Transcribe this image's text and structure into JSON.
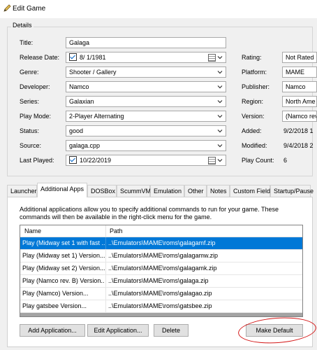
{
  "window": {
    "title": "Edit Game",
    "icon": "pencil-icon"
  },
  "details": {
    "group_label": "Details",
    "title": {
      "label": "Title:",
      "value": "Galaga"
    },
    "release_date": {
      "label": "Release Date:",
      "value": "8/  1/1981",
      "checked": true
    },
    "genre": {
      "label": "Genre:",
      "value": "Shooter / Gallery"
    },
    "developer": {
      "label": "Developer:",
      "value": "Namco"
    },
    "series": {
      "label": "Series:",
      "value": "Galaxian"
    },
    "play_mode": {
      "label": "Play Mode:",
      "value": "2-Player Alternating"
    },
    "status": {
      "label": "Status:",
      "value": "good"
    },
    "source": {
      "label": "Source:",
      "value": "galaga.cpp"
    },
    "last_played": {
      "label": "Last Played:",
      "value": "10/22/2019",
      "checked": true
    },
    "rating": {
      "label": "Rating:",
      "value": "Not Rated"
    },
    "platform": {
      "label": "Platform:",
      "value": "MAME"
    },
    "publisher": {
      "label": "Publisher:",
      "value": "Namco"
    },
    "region": {
      "label": "Region:",
      "value": "North Ame"
    },
    "version": {
      "label": "Version:",
      "value": "(Namco rev"
    },
    "added": {
      "label": "Added:",
      "value": "9/2/2018 1"
    },
    "modified": {
      "label": "Modified:",
      "value": "9/4/2018 2"
    },
    "play_count": {
      "label": "Play Count:",
      "value": "6"
    }
  },
  "tabs": [
    "Launcher",
    "Additional Apps",
    "DOSBox",
    "ScummVM",
    "Emulation",
    "Other",
    "Notes",
    "Custom Fields",
    "Startup/Pause"
  ],
  "active_tab": "Additional Apps",
  "additional_apps": {
    "description": "Additional applications allow you to specify additional commands to run for your game.  These commands will then be available in the right-click menu for the game.",
    "columns": [
      "Name",
      "Path"
    ],
    "rows": [
      {
        "name": "Play (Midway set 1 with fast ...",
        "path": "..\\Emulators\\MAME\\roms\\galagamf.zip",
        "selected": true
      },
      {
        "name": "Play (Midway set 1) Version...",
        "path": "..\\Emulators\\MAME\\roms\\galagamw.zip",
        "selected": false
      },
      {
        "name": "Play (Midway set 2) Version...",
        "path": "..\\Emulators\\MAME\\roms\\galagamk.zip",
        "selected": false
      },
      {
        "name": "Play (Namco rev. B) Version...",
        "path": "..\\Emulators\\MAME\\roms\\galaga.zip",
        "selected": false
      },
      {
        "name": "Play (Namco) Version...",
        "path": "..\\Emulators\\MAME\\roms\\galagao.zip",
        "selected": false
      },
      {
        "name": "Play gatsbee Version...",
        "path": "..\\Emulators\\MAME\\roms\\gatsbee.zip",
        "selected": false
      }
    ],
    "buttons": {
      "add": "Add Application...",
      "edit": "Edit Application...",
      "delete": "Delete",
      "make_default": "Make Default"
    }
  },
  "colors": {
    "selection": "#0078d7",
    "annotation_circle": "#d31616"
  }
}
